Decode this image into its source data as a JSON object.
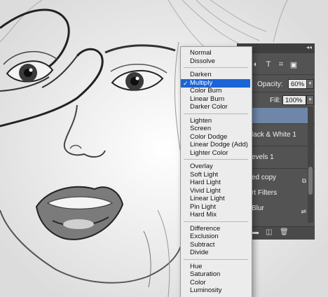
{
  "blend_menu": {
    "groups": [
      [
        "Normal",
        "Dissolve"
      ],
      [
        "Darken",
        "Multiply",
        "Color Burn",
        "Linear Burn",
        "Darker Color"
      ],
      [
        "Lighten",
        "Screen",
        "Color Dodge",
        "Linear Dodge (Add)",
        "Lighter Color"
      ],
      [
        "Overlay",
        "Soft Light",
        "Hard Light",
        "Vivid Light",
        "Linear Light",
        "Pin Light",
        "Hard Mix"
      ],
      [
        "Difference",
        "Exclusion",
        "Subtract",
        "Divide"
      ],
      [
        "Hue",
        "Saturation",
        "Color",
        "Luminosity"
      ]
    ],
    "selected": "Multiply",
    "check_glyph": "✓",
    "selected_color": "#1c63d6"
  },
  "layers_panel": {
    "opacity_label": "Opacity:",
    "opacity_value": "60%",
    "fill_label": "Fill:",
    "fill_value": "100%",
    "layers": [
      {
        "label": "",
        "selected": true,
        "icon": ""
      },
      {
        "label": "lack & White 1",
        "selected": false,
        "icon": ""
      },
      {
        "label": "evels 1",
        "selected": false,
        "icon": ""
      },
      {
        "label": "ed copy",
        "selected": false,
        "icon": "smart-object-icon"
      },
      {
        "label": "rt Filters",
        "selected": false,
        "icon": ""
      },
      {
        "label": "Blur",
        "selected": false,
        "icon": "filter-options-icon"
      }
    ]
  }
}
